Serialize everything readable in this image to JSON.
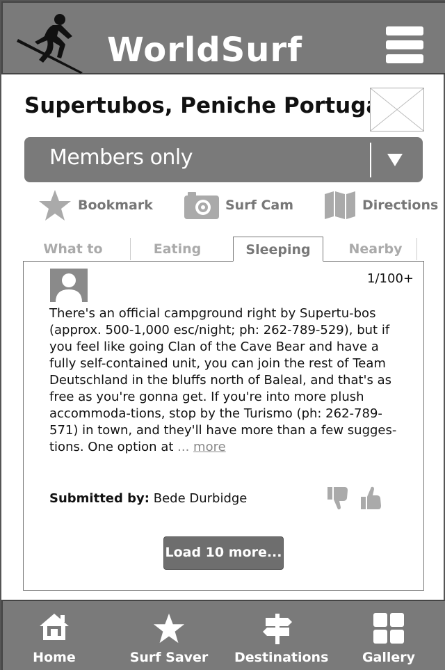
{
  "header": {
    "app_title": "WorldSurf",
    "logo_icon": "surfer-logo-icon",
    "menu_icon": "hamburger-menu-icon"
  },
  "page": {
    "title": "Supertubos, Peniche Portugal"
  },
  "members_select": {
    "value": "Members only"
  },
  "actions": [
    {
      "label": "Bookmark",
      "icon": "star-icon"
    },
    {
      "label": "Surf Cam",
      "icon": "camera-icon"
    },
    {
      "label": "Directions",
      "icon": "map-icon"
    }
  ],
  "tabs": [
    {
      "label": "What to Bring",
      "active": false
    },
    {
      "label": "Eating",
      "active": false
    },
    {
      "label": "Sleeping",
      "active": true
    },
    {
      "label": "Nearby",
      "active": false
    }
  ],
  "review": {
    "counter": "1/100+",
    "text": "There's an official campground right by Supertu-bos (approx. 500-1,000 esc/night; ph: 262-789-529), but if you feel like going Clan of the Cave Bear and have a fully self-contained unit, you can join the rest of Team Deutschland in the bluffs north of Baleal, and that's as free as you're gonna get. If you're into more plush accommoda-tions, stop by the Turismo (ph: 262-789-571) in town, and they'll have more than a few sugges-tions. One option at",
    "ellipsis": "...",
    "more_label": "more",
    "submitted_label": "Submitted by:",
    "submitted_by": "Bede Durbidge"
  },
  "load_more_label": "Load 10 more...",
  "bottom_nav": [
    {
      "label": "Home",
      "icon": "home-icon"
    },
    {
      "label": "Surf Saver",
      "icon": "star-icon"
    },
    {
      "label": "Destinations",
      "icon": "signpost-icon"
    },
    {
      "label": "Gallery",
      "icon": "grid-icon"
    }
  ],
  "colors": {
    "bar": "#7a7a7a",
    "text": "#111111",
    "muted": "#888888"
  }
}
